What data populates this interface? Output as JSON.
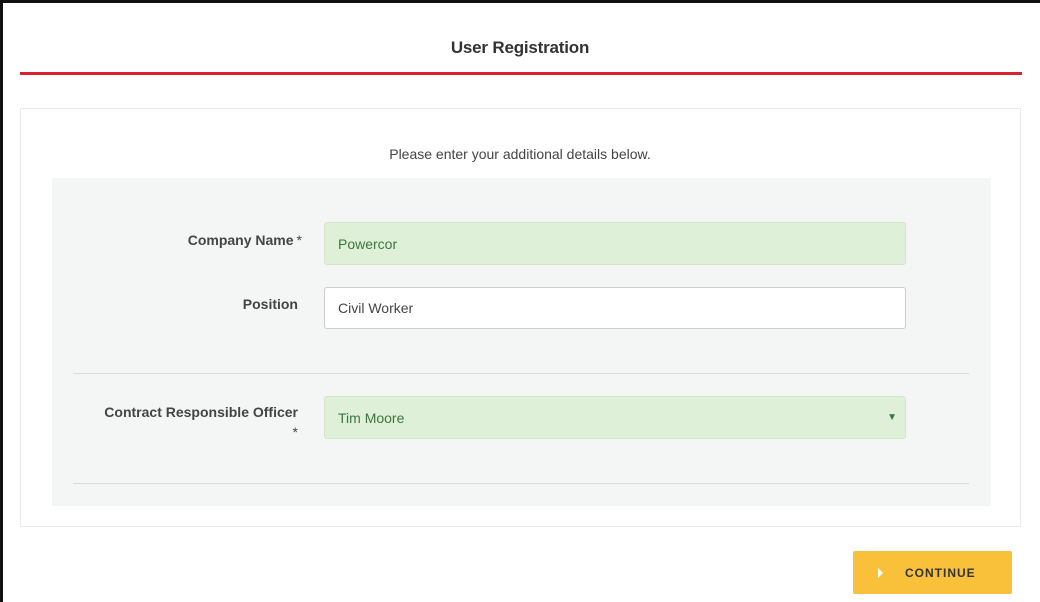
{
  "header": {
    "title": "User Registration"
  },
  "form": {
    "intro": "Please enter your additional details below.",
    "required_marker": "*",
    "company_name": {
      "label": "Company Name",
      "value": "Powercor"
    },
    "position": {
      "label": "Position",
      "value": "Civil Worker"
    },
    "contract_officer": {
      "label": "Contract Responsible Officer",
      "value": "Tim Moore",
      "arrow": "▼"
    }
  },
  "actions": {
    "continue_label": "CONTINUE"
  },
  "colors": {
    "accent_rule": "#d9242f",
    "button": "#f9c13a",
    "valid_bg": "#dff0d8"
  },
  "icons": {
    "continue": "caret-right-icon",
    "select": "chevron-down-icon"
  }
}
